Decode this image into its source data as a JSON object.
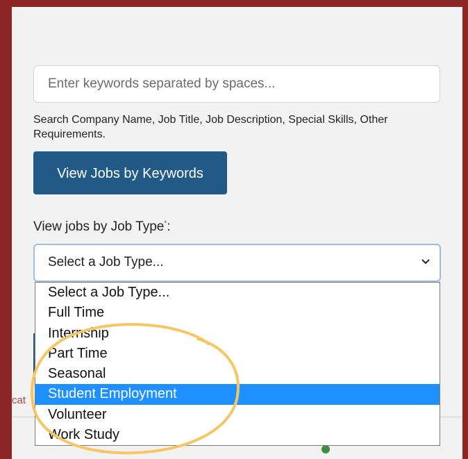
{
  "search": {
    "placeholder": "Enter keywords separated by spaces...",
    "help_text": "Search Company Name, Job Title, Job Description, Special Skills, Other Requirements."
  },
  "keywords_button": {
    "label": "View Jobs by Keywords"
  },
  "job_type": {
    "label": "View jobs by Job Type",
    "required_marker": "*",
    "colon": ":",
    "selected": "Select a Job Type...",
    "options": [
      "Select a Job Type...",
      "Full Time",
      "Internship",
      "Part Time",
      "Seasonal",
      "Student Employment",
      "Volunteer",
      "Work Study"
    ],
    "highlighted_index": 5
  },
  "background": {
    "partial_text": "cat"
  },
  "colors": {
    "page_border": "#8b2624",
    "panel": "#f2f2f2",
    "button": "#215a86",
    "highlight": "#1e90ff",
    "annotation_circle": "#f4c763"
  }
}
